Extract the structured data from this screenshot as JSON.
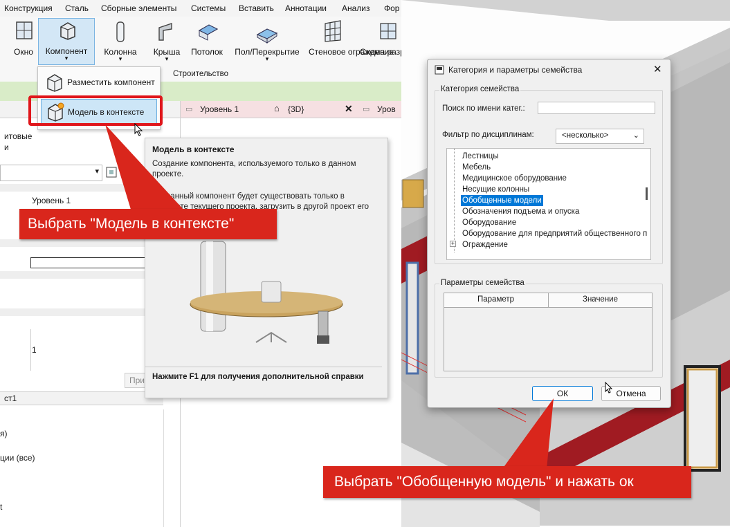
{
  "menubar": {
    "items": [
      "Конструкция",
      "Сталь",
      "Сборные элементы",
      "Системы",
      "Вставить",
      "Аннотации",
      "Анализ",
      "Фор"
    ]
  },
  "ribbon": {
    "buttons": [
      "Окно",
      "Компонент",
      "Колонна",
      "Крыша",
      "Потолок",
      "Пол/Перекрытие",
      "Стеновое ограждение",
      "Схема разр стены"
    ],
    "group_label": "Строительство"
  },
  "component_menu": {
    "items": [
      "Разместить компонент",
      "Модель в контексте"
    ]
  },
  "view_tabs": [
    {
      "label": "Уровень 1"
    },
    {
      "label": "{3D}"
    },
    {
      "label": "Уров"
    }
  ],
  "properties": {
    "fragment_label": "итовые",
    "fragment_label2": "и",
    "level_value": "Уровень 1",
    "number_value": "1",
    "apply_fragment": "При",
    "browser_label": "ст1",
    "browser_items": [
      "я)",
      "ции (все)",
      "t"
    ]
  },
  "tooltip": {
    "title": "Модель в контексте",
    "text1": "Создание компонента, используемого только в данном проекте.",
    "text2": "Созданный компонент будет существовать только в контексте текущего проекта. загрузить в другой проект его",
    "help": "Нажмите F1 для получения дополнительной справки"
  },
  "callouts": {
    "left": "Выбрать \"Модель в контексте\"",
    "right": "Выбрать \"Обобщенную модель\" и нажать ок"
  },
  "dialog": {
    "title": "Категория и параметры семейства",
    "group_category": "Категория семейства",
    "search_label": "Поиск по имени катег.:",
    "search_value": "",
    "filter_label": "Фильтр по дисциплинам:",
    "filter_value": "<несколько>",
    "categories": [
      "Лестницы",
      "Мебель",
      "Медицинское оборудование",
      "Несущие колонны",
      "Обобщенные модели",
      "Обозначения подъема и опуска",
      "Оборудование",
      "Оборудование для предприятий общественного п",
      "Ограждение"
    ],
    "selected_category": "Обобщенные модели",
    "group_params": "Параметры семейства",
    "col_param": "Параметр",
    "col_value": "Значение",
    "ok_label": "ОК",
    "cancel_label": "Отмена"
  },
  "colors": {
    "accent_red": "#d9261c",
    "selection_blue": "#0078d7",
    "ribbon_green": "#d9ecc8"
  }
}
